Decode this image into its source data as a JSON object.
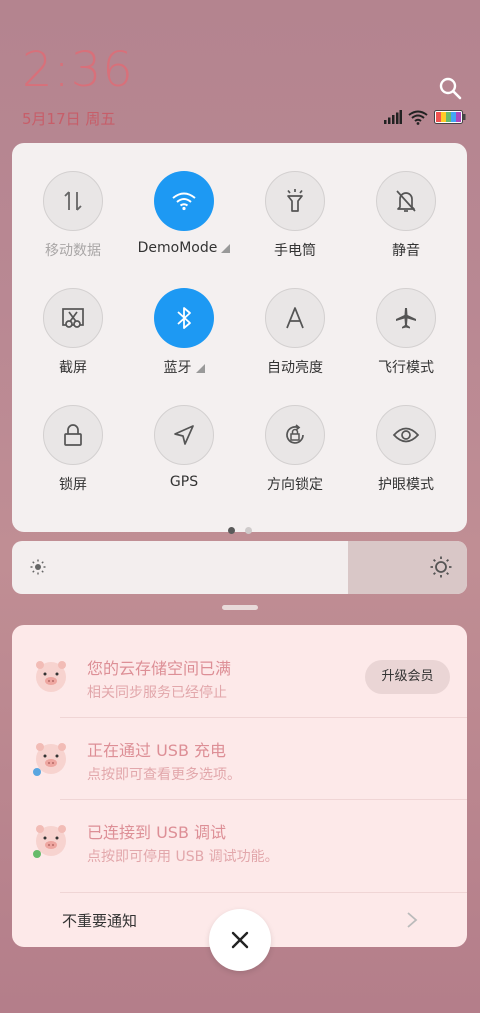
{
  "status": {
    "time": "2:36",
    "date": "5月17日 周五"
  },
  "icons": {
    "search": "search-icon",
    "signal": "signal-icon",
    "wifi": "wifi-icon",
    "battery": "battery-icon"
  },
  "colors": {
    "accent": "#1d99f3",
    "clock": "#d8707a"
  },
  "tiles": [
    {
      "label": "移动数据",
      "icon": "mobile-data-icon",
      "active": false,
      "dim": true
    },
    {
      "label": "DemoMode",
      "icon": "wifi-icon",
      "active": true,
      "expand": true
    },
    {
      "label": "手电筒",
      "icon": "flashlight-icon",
      "active": false
    },
    {
      "label": "静音",
      "icon": "mute-bell-icon",
      "active": false
    },
    {
      "label": "截屏",
      "icon": "screenshot-icon",
      "active": false
    },
    {
      "label": "蓝牙",
      "icon": "bluetooth-icon",
      "active": true,
      "expand": true
    },
    {
      "label": "自动亮度",
      "icon": "auto-brightness-icon",
      "active": false
    },
    {
      "label": "飞行模式",
      "icon": "airplane-icon",
      "active": false
    },
    {
      "label": "锁屏",
      "icon": "lock-icon",
      "active": false
    },
    {
      "label": "GPS",
      "icon": "gps-icon",
      "active": false
    },
    {
      "label": "方向锁定",
      "icon": "rotation-lock-icon",
      "active": false
    },
    {
      "label": "护眼模式",
      "icon": "eye-icon",
      "active": false
    }
  ],
  "pager": {
    "pages": 2,
    "current": 1
  },
  "brightness": {
    "level": 0.74
  },
  "notifications": [
    {
      "title": "您的云存储空间已满",
      "subtitle": "相关同步服务已经停止",
      "action": "升级会员"
    },
    {
      "title": "正在通过 USB 充电",
      "subtitle": "点按即可查看更多选项。"
    },
    {
      "title": "已连接到 USB 调试",
      "subtitle": "点按即可停用 USB 调试功能。"
    }
  ],
  "footer": {
    "unimportant": "不重要通知"
  }
}
